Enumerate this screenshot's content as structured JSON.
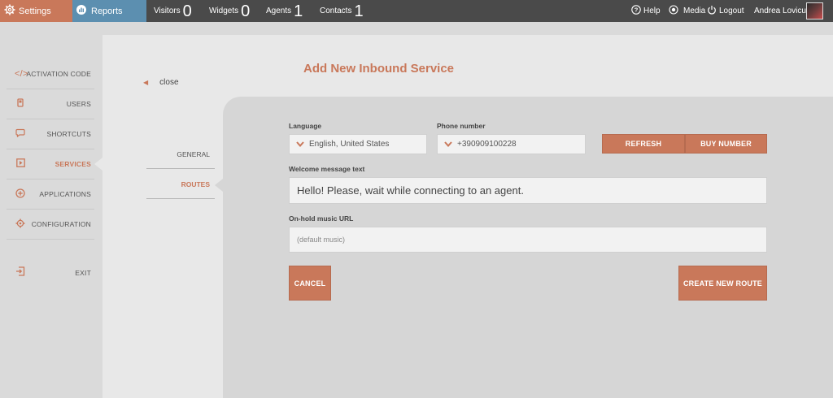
{
  "topbar": {
    "settings_label": "Settings",
    "reports_label": "Reports",
    "stats": [
      {
        "label": "Visitors",
        "value": "0"
      },
      {
        "label": "Widgets",
        "value": "0"
      },
      {
        "label": "Agents",
        "value": "1"
      },
      {
        "label": "Contacts",
        "value": "1"
      }
    ],
    "help_label": "Help",
    "media_label": "Media",
    "logout_label": "Logout",
    "user_name": "Andrea Lovicu"
  },
  "sidebar": {
    "items": [
      {
        "label": "ACTIVATION CODE",
        "icon": "code-icon"
      },
      {
        "label": "USERS",
        "icon": "user-icon"
      },
      {
        "label": "SHORTCUTS",
        "icon": "speech-bubble-icon"
      },
      {
        "label": "SERVICES",
        "icon": "play-box-icon",
        "active": true
      },
      {
        "label": "APPLICATIONS",
        "icon": "plus-circle-icon"
      },
      {
        "label": "CONFIGURATION",
        "icon": "gear-icon"
      },
      {
        "label": "EXIT",
        "icon": "exit-icon"
      }
    ]
  },
  "main": {
    "close_label": "close",
    "title": "Add New Inbound Service",
    "subnav": [
      {
        "label": "GENERAL"
      },
      {
        "label": "ROUTES",
        "active": true
      }
    ]
  },
  "form": {
    "language_label": "Language",
    "language_value": "English, United States",
    "phone_label": "Phone number",
    "phone_value": "+390909100228",
    "refresh_label": "REFRESH",
    "buy_label": "BUY NUMBER",
    "welcome_label": "Welcome message text",
    "welcome_value": "Hello! Please, wait while connecting to an agent.",
    "onhold_label": "On-hold music URL",
    "onhold_placeholder": "(default music)",
    "cancel_label": "CANCEL",
    "create_label": "CREATE NEW ROUTE"
  },
  "colors": {
    "accent": "#c9785a",
    "reports_blue": "#5c8fb0",
    "topbar_bg": "#4a4a4a"
  }
}
